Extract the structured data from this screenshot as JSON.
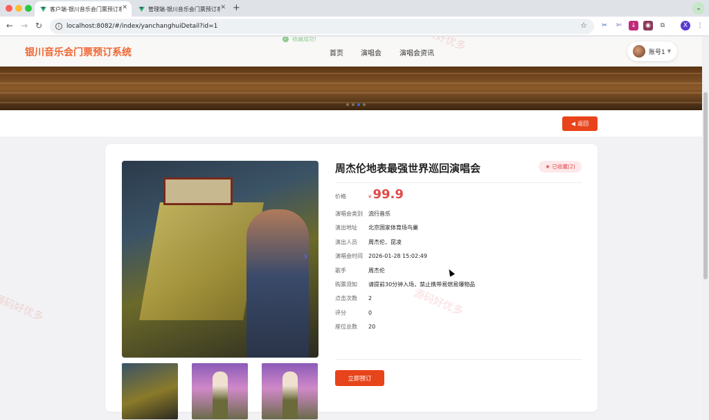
{
  "browser": {
    "tabs": [
      {
        "title": "客户端-银川音乐会门票预订系统",
        "active": true
      },
      {
        "title": "管理端-银川音乐会门票预订系统",
        "active": false
      }
    ],
    "url": "localhost:8082/#/index/yanchanghuiDetail?id=1",
    "profile_initial": "X"
  },
  "header": {
    "logo": "银川音乐会门票预订系统",
    "nav": [
      "首页",
      "演唱会",
      "演唱会资讯"
    ],
    "toast": "收藏成功!",
    "account": "账号1"
  },
  "back_label": "返回",
  "detail": {
    "title": "周杰伦地表最强世界巡回演唱会",
    "favorite_label": "已收藏(2)",
    "price_label": "价格",
    "currency": "¥",
    "price": "99.9",
    "fields": [
      {
        "label": "演唱会类别",
        "value": "流行音乐"
      },
      {
        "label": "演出地址",
        "value": "北京国家体育场鸟巢"
      },
      {
        "label": "演出人员",
        "value": "周杰伦、昆凌"
      },
      {
        "label": "演唱会时间",
        "value": "2026-01-28 15:02:49"
      },
      {
        "label": "歌手",
        "value": "周杰伦"
      },
      {
        "label": "购票须知",
        "value": "请提前30分钟入场，禁止携带易燃易爆物品"
      },
      {
        "label": "点击次数",
        "value": "2"
      },
      {
        "label": "评分",
        "value": "0"
      },
      {
        "label": "座位总数",
        "value": "20"
      }
    ],
    "book_label": "立即预订"
  },
  "watermark": "源码好优多",
  "colors": {
    "brand": "#f06632",
    "button": "#e8441b",
    "price": "#e04848"
  }
}
